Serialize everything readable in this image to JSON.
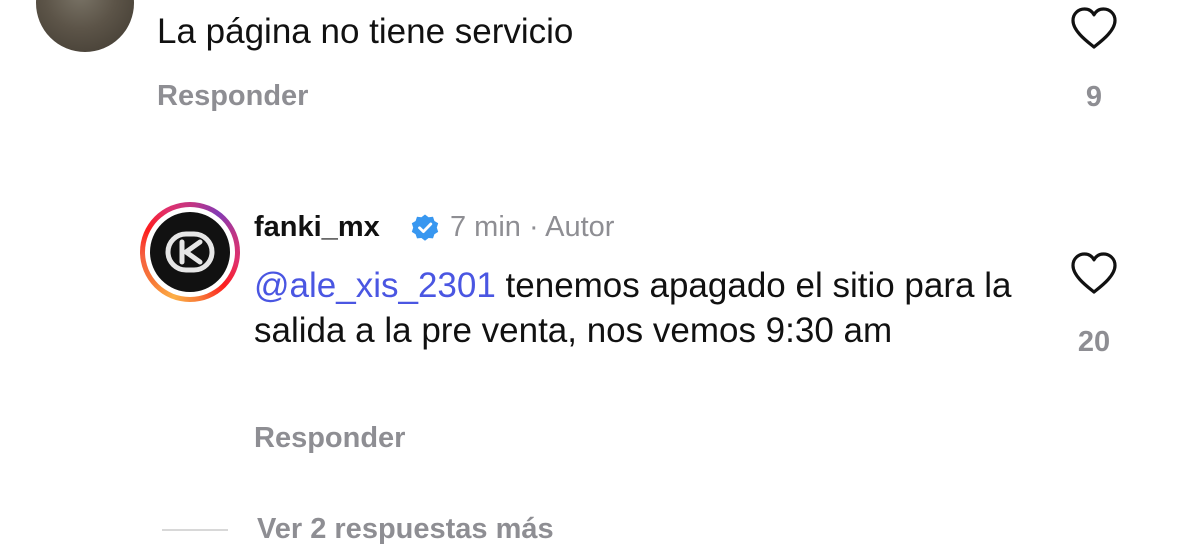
{
  "comments": [
    {
      "text": "La página no tiene servicio",
      "reply_label": "Responder",
      "like_count": "9"
    },
    {
      "username": "fanki_mx",
      "time": "7 min",
      "separator": "·",
      "author_label": "Autor",
      "mention": "@ale_xis_2301",
      "text": " tenemos apagado el sitio para la salida a la pre venta, nos vemos 9:30 am",
      "reply_label": "Responder",
      "like_count": "20"
    }
  ],
  "view_replies_label": "Ver 2 respuestas más",
  "colors": {
    "text_primary": "#111111",
    "text_secondary": "#8e8e93",
    "mention": "#4a56e2",
    "verified": "#3897f0"
  },
  "icons": {
    "like": "heart-outline-icon",
    "verified": "verified-badge-icon"
  }
}
